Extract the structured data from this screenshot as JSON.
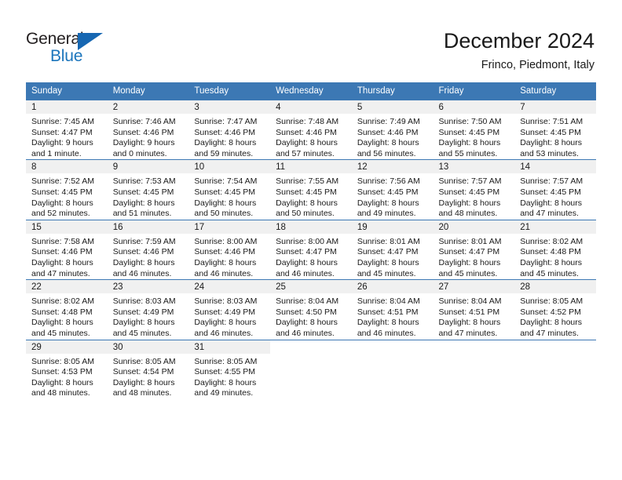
{
  "brand": {
    "name_part1": "General",
    "name_part2": "Blue",
    "flag_icon": "blue-triangle-flag",
    "color_dark": "#231f20",
    "color_blue": "#1b75bc"
  },
  "header": {
    "title": "December 2024",
    "location": "Frinco, Piedmont, Italy"
  },
  "theme": {
    "header_row_bg": "#3c78b4",
    "daynum_bg": "#f0f0f0",
    "text": "#1a1a1a"
  },
  "calendar": {
    "weekday_headers": [
      "Sunday",
      "Monday",
      "Tuesday",
      "Wednesday",
      "Thursday",
      "Friday",
      "Saturday"
    ],
    "weeks": [
      [
        {
          "day": "1",
          "sunrise": "Sunrise: 7:45 AM",
          "sunset": "Sunset: 4:47 PM",
          "daylight_line1": "Daylight: 9 hours",
          "daylight_line2": "and 1 minute."
        },
        {
          "day": "2",
          "sunrise": "Sunrise: 7:46 AM",
          "sunset": "Sunset: 4:46 PM",
          "daylight_line1": "Daylight: 9 hours",
          "daylight_line2": "and 0 minutes."
        },
        {
          "day": "3",
          "sunrise": "Sunrise: 7:47 AM",
          "sunset": "Sunset: 4:46 PM",
          "daylight_line1": "Daylight: 8 hours",
          "daylight_line2": "and 59 minutes."
        },
        {
          "day": "4",
          "sunrise": "Sunrise: 7:48 AM",
          "sunset": "Sunset: 4:46 PM",
          "daylight_line1": "Daylight: 8 hours",
          "daylight_line2": "and 57 minutes."
        },
        {
          "day": "5",
          "sunrise": "Sunrise: 7:49 AM",
          "sunset": "Sunset: 4:46 PM",
          "daylight_line1": "Daylight: 8 hours",
          "daylight_line2": "and 56 minutes."
        },
        {
          "day": "6",
          "sunrise": "Sunrise: 7:50 AM",
          "sunset": "Sunset: 4:45 PM",
          "daylight_line1": "Daylight: 8 hours",
          "daylight_line2": "and 55 minutes."
        },
        {
          "day": "7",
          "sunrise": "Sunrise: 7:51 AM",
          "sunset": "Sunset: 4:45 PM",
          "daylight_line1": "Daylight: 8 hours",
          "daylight_line2": "and 53 minutes."
        }
      ],
      [
        {
          "day": "8",
          "sunrise": "Sunrise: 7:52 AM",
          "sunset": "Sunset: 4:45 PM",
          "daylight_line1": "Daylight: 8 hours",
          "daylight_line2": "and 52 minutes."
        },
        {
          "day": "9",
          "sunrise": "Sunrise: 7:53 AM",
          "sunset": "Sunset: 4:45 PM",
          "daylight_line1": "Daylight: 8 hours",
          "daylight_line2": "and 51 minutes."
        },
        {
          "day": "10",
          "sunrise": "Sunrise: 7:54 AM",
          "sunset": "Sunset: 4:45 PM",
          "daylight_line1": "Daylight: 8 hours",
          "daylight_line2": "and 50 minutes."
        },
        {
          "day": "11",
          "sunrise": "Sunrise: 7:55 AM",
          "sunset": "Sunset: 4:45 PM",
          "daylight_line1": "Daylight: 8 hours",
          "daylight_line2": "and 50 minutes."
        },
        {
          "day": "12",
          "sunrise": "Sunrise: 7:56 AM",
          "sunset": "Sunset: 4:45 PM",
          "daylight_line1": "Daylight: 8 hours",
          "daylight_line2": "and 49 minutes."
        },
        {
          "day": "13",
          "sunrise": "Sunrise: 7:57 AM",
          "sunset": "Sunset: 4:45 PM",
          "daylight_line1": "Daylight: 8 hours",
          "daylight_line2": "and 48 minutes."
        },
        {
          "day": "14",
          "sunrise": "Sunrise: 7:57 AM",
          "sunset": "Sunset: 4:45 PM",
          "daylight_line1": "Daylight: 8 hours",
          "daylight_line2": "and 47 minutes."
        }
      ],
      [
        {
          "day": "15",
          "sunrise": "Sunrise: 7:58 AM",
          "sunset": "Sunset: 4:46 PM",
          "daylight_line1": "Daylight: 8 hours",
          "daylight_line2": "and 47 minutes."
        },
        {
          "day": "16",
          "sunrise": "Sunrise: 7:59 AM",
          "sunset": "Sunset: 4:46 PM",
          "daylight_line1": "Daylight: 8 hours",
          "daylight_line2": "and 46 minutes."
        },
        {
          "day": "17",
          "sunrise": "Sunrise: 8:00 AM",
          "sunset": "Sunset: 4:46 PM",
          "daylight_line1": "Daylight: 8 hours",
          "daylight_line2": "and 46 minutes."
        },
        {
          "day": "18",
          "sunrise": "Sunrise: 8:00 AM",
          "sunset": "Sunset: 4:47 PM",
          "daylight_line1": "Daylight: 8 hours",
          "daylight_line2": "and 46 minutes."
        },
        {
          "day": "19",
          "sunrise": "Sunrise: 8:01 AM",
          "sunset": "Sunset: 4:47 PM",
          "daylight_line1": "Daylight: 8 hours",
          "daylight_line2": "and 45 minutes."
        },
        {
          "day": "20",
          "sunrise": "Sunrise: 8:01 AM",
          "sunset": "Sunset: 4:47 PM",
          "daylight_line1": "Daylight: 8 hours",
          "daylight_line2": "and 45 minutes."
        },
        {
          "day": "21",
          "sunrise": "Sunrise: 8:02 AM",
          "sunset": "Sunset: 4:48 PM",
          "daylight_line1": "Daylight: 8 hours",
          "daylight_line2": "and 45 minutes."
        }
      ],
      [
        {
          "day": "22",
          "sunrise": "Sunrise: 8:02 AM",
          "sunset": "Sunset: 4:48 PM",
          "daylight_line1": "Daylight: 8 hours",
          "daylight_line2": "and 45 minutes."
        },
        {
          "day": "23",
          "sunrise": "Sunrise: 8:03 AM",
          "sunset": "Sunset: 4:49 PM",
          "daylight_line1": "Daylight: 8 hours",
          "daylight_line2": "and 45 minutes."
        },
        {
          "day": "24",
          "sunrise": "Sunrise: 8:03 AM",
          "sunset": "Sunset: 4:49 PM",
          "daylight_line1": "Daylight: 8 hours",
          "daylight_line2": "and 46 minutes."
        },
        {
          "day": "25",
          "sunrise": "Sunrise: 8:04 AM",
          "sunset": "Sunset: 4:50 PM",
          "daylight_line1": "Daylight: 8 hours",
          "daylight_line2": "and 46 minutes."
        },
        {
          "day": "26",
          "sunrise": "Sunrise: 8:04 AM",
          "sunset": "Sunset: 4:51 PM",
          "daylight_line1": "Daylight: 8 hours",
          "daylight_line2": "and 46 minutes."
        },
        {
          "day": "27",
          "sunrise": "Sunrise: 8:04 AM",
          "sunset": "Sunset: 4:51 PM",
          "daylight_line1": "Daylight: 8 hours",
          "daylight_line2": "and 47 minutes."
        },
        {
          "day": "28",
          "sunrise": "Sunrise: 8:05 AM",
          "sunset": "Sunset: 4:52 PM",
          "daylight_line1": "Daylight: 8 hours",
          "daylight_line2": "and 47 minutes."
        }
      ],
      [
        {
          "day": "29",
          "sunrise": "Sunrise: 8:05 AM",
          "sunset": "Sunset: 4:53 PM",
          "daylight_line1": "Daylight: 8 hours",
          "daylight_line2": "and 48 minutes."
        },
        {
          "day": "30",
          "sunrise": "Sunrise: 8:05 AM",
          "sunset": "Sunset: 4:54 PM",
          "daylight_line1": "Daylight: 8 hours",
          "daylight_line2": "and 48 minutes."
        },
        {
          "day": "31",
          "sunrise": "Sunrise: 8:05 AM",
          "sunset": "Sunset: 4:55 PM",
          "daylight_line1": "Daylight: 8 hours",
          "daylight_line2": "and 49 minutes."
        },
        {
          "day": "",
          "sunrise": "",
          "sunset": "",
          "daylight_line1": "",
          "daylight_line2": ""
        },
        {
          "day": "",
          "sunrise": "",
          "sunset": "",
          "daylight_line1": "",
          "daylight_line2": ""
        },
        {
          "day": "",
          "sunrise": "",
          "sunset": "",
          "daylight_line1": "",
          "daylight_line2": ""
        },
        {
          "day": "",
          "sunrise": "",
          "sunset": "",
          "daylight_line1": "",
          "daylight_line2": ""
        }
      ]
    ]
  }
}
